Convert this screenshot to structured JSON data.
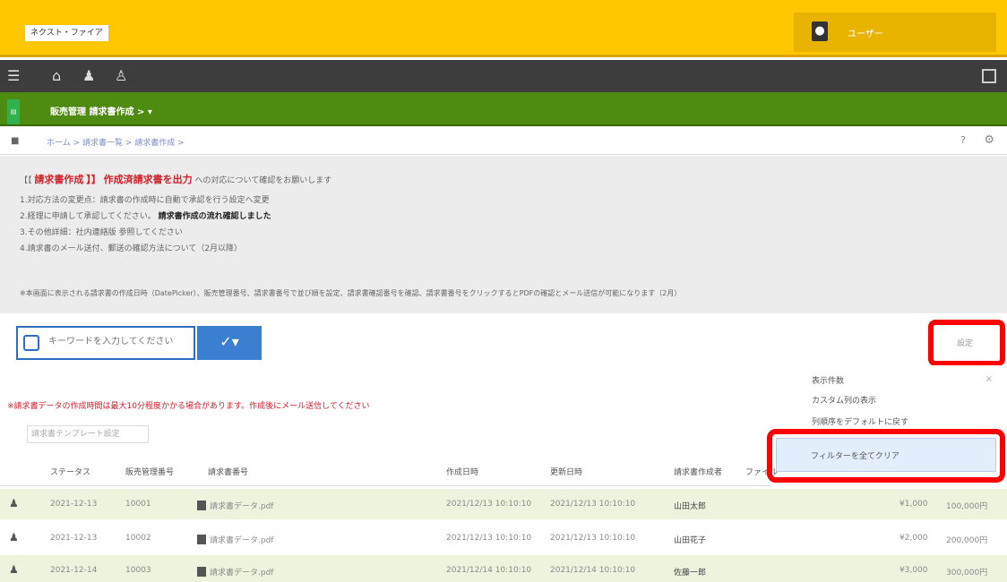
{
  "header": {
    "logo": "ネクスト・ファイア",
    "user": "ユーザー"
  },
  "nav": {
    "icons": [
      "hamburger-icon",
      "home-icon",
      "people-icon",
      "person-icon"
    ]
  },
  "breadcrumb": {
    "main": "販売管理 請求書作成 > ▾",
    "sub": "ホーム > 請求書一覧 > 請求書作成 >"
  },
  "notice": {
    "line1_prefix": "【【",
    "line1_red1": "請求書作成",
    "line1_mid": "】】",
    "line1_red2": "作成済請求書を出力",
    "line1_rest": "への対応について確認をお願いします",
    "line2": "1.対応方法の変更点：請求書の作成時に自動で承認を行う設定へ変更",
    "line3_prefix": "2.経理に申請して承認してください。",
    "line3_bold": "請求書作成の流れ確認しました",
    "line4": "3.その他詳細：社内連絡版 参照してください",
    "line5": "4.請求書のメール送付、郵送の確認方法について（2月以降）",
    "line6": "※本画面に表示される請求書の作成日時（DatePicker）、販売管理番号、請求書番号で並び順を設定、請求書確認番号を確認、請求書番号をクリックするとPDFの確認とメール送信が可能になります（2月）"
  },
  "search": {
    "placeholder": "キーワードを入力してください"
  },
  "top_right_button": "設定",
  "dropdown": {
    "items": [
      "表示件数",
      "カスタム列の表示",
      "列順序をデフォルトに戻す"
    ],
    "highlighted_item": "フィルターを全てクリア"
  },
  "warning_text": "※請求書データの作成時間は最大10分程度かかる場合があります。作成後にメール送信してください",
  "sub_link": "請求書テンプレート設定",
  "table": {
    "headers": [
      "ステータス",
      "販売管理番号",
      "請求書番号",
      "作成日時",
      "更新日時",
      "請求書作成者",
      "ファイル"
    ],
    "rows": [
      {
        "date": "2021-12-13",
        "num": "10001",
        "file": "請求書データ.pdf",
        "created": "2021/12/13 10:10:10",
        "updated": "2021/12/13 10:10:10",
        "owner": "山田太郎",
        "amount": "¥1,000",
        "total": "100,000円"
      },
      {
        "date": "2021-12-13",
        "num": "10002",
        "file": "請求書データ.pdf",
        "created": "2021/12/13 10:10:10",
        "updated": "2021/12/13 10:10:10",
        "owner": "山田花子",
        "amount": "¥2,000",
        "total": "200,000円"
      },
      {
        "date": "2021-12-14",
        "num": "10003",
        "file": "請求書データ.pdf",
        "created": "2021/12/14 10:10:10",
        "updated": "2021/12/14 10:10:10",
        "owner": "佐藤一郎",
        "amount": "¥3,000",
        "total": "300,000円"
      }
    ]
  },
  "colors": {
    "topbar": "#ffc700",
    "navbar": "#3d3d3d",
    "greenbar": "#4e8b10",
    "highlight": "#ff0000",
    "accent": "#3a7fd0"
  }
}
